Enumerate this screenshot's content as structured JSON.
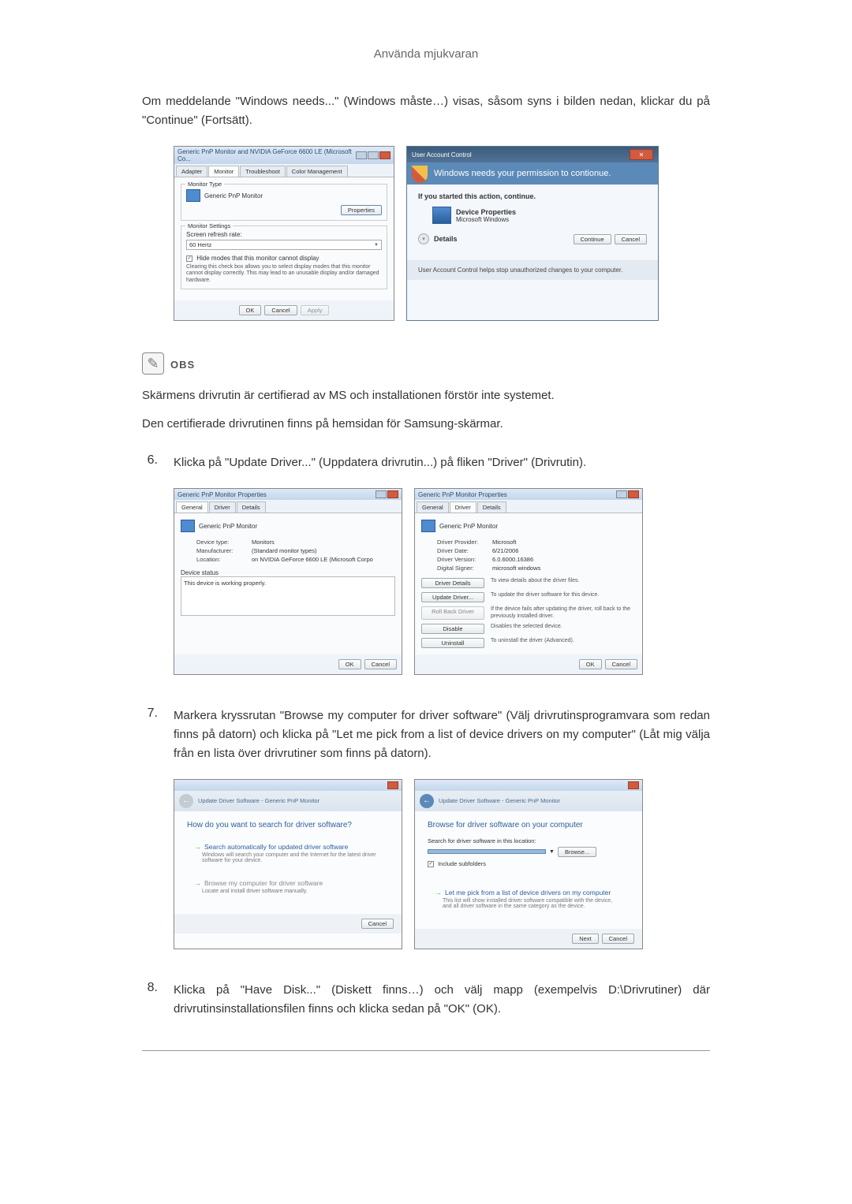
{
  "header": {
    "title": "Använda mjukvaran"
  },
  "intro_para": "Om meddelande \"Windows needs...\" (Windows måste…) visas, såsom syns i bilden nedan, klickar du på \"Continue\" (Fortsätt).",
  "fig1_left": {
    "title": "Generic PnP Monitor and NVIDIA GeForce 6600 LE (Microsoft Co...",
    "tabs": {
      "adapter": "Adapter",
      "monitor": "Monitor",
      "troubleshoot": "Troubleshoot",
      "color": "Color Management"
    },
    "group_monitor_type": "Monitor Type",
    "monitor_name": "Generic PnP Monitor",
    "btn_properties": "Properties",
    "group_monitor_settings": "Monitor Settings",
    "refresh_label": "Screen refresh rate:",
    "refresh_value": "60 Hertz",
    "hide_modes_check": "Hide modes that this monitor cannot display",
    "hide_modes_desc": "Clearing this check box allows you to select display modes that this monitor cannot display correctly. This may lead to an unusable display and/or damaged hardware.",
    "btn_ok": "OK",
    "btn_cancel": "Cancel",
    "btn_apply": "Apply"
  },
  "fig1_right": {
    "title": "User Account Control",
    "banner": "Windows needs your permission to contionue.",
    "sub": "If you started this action, continue.",
    "app_name": "Device Properties",
    "publisher": "Microsoft Windows",
    "details_label": "Details",
    "btn_continue": "Continue",
    "btn_cancel": "Cancel",
    "footer": "User Account Control helps stop unauthorized changes to your computer."
  },
  "note": {
    "label": "OBS",
    "line1": "Skärmens drivrutin är certifierad av MS och installationen förstör inte systemet.",
    "line2": "Den certifierade drivrutinen finns på hemsidan för Samsung-skärmar."
  },
  "step6": {
    "num": "6.",
    "text": "Klicka på \"Update Driver...\" (Uppdatera drivrutin...) på fliken \"Driver\" (Drivrutin)."
  },
  "fig2_left": {
    "title": "Generic PnP Monitor Properties",
    "tabs": {
      "general": "General",
      "driver": "Driver",
      "details": "Details"
    },
    "monitor_name": "Generic PnP Monitor",
    "fields": {
      "device_type_l": "Device type:",
      "device_type_v": "Monitors",
      "manufacturer_l": "Manufacturer:",
      "manufacturer_v": "(Standard monitor types)",
      "location_l": "Location:",
      "location_v": "on NVIDIA GeForce 6600 LE (Microsoft Corpo"
    },
    "status_label": "Device status",
    "status_text": "This device is working properly.",
    "btn_ok": "OK",
    "btn_cancel": "Cancel"
  },
  "fig2_right": {
    "title": "Generic PnP Monitor Properties",
    "tabs": {
      "general": "General",
      "driver": "Driver",
      "details": "Details"
    },
    "monitor_name": "Generic PnP Monitor",
    "fields": {
      "provider_l": "Driver Provider:",
      "provider_v": "Microsoft",
      "date_l": "Driver Date:",
      "date_v": "6/21/2006",
      "version_l": "Driver Version:",
      "version_v": "6.0.6000.16386",
      "signer_l": "Digital Signer:",
      "signer_v": "microsoft windows"
    },
    "btn_details": "Driver Details",
    "desc_details": "To view details about the driver files.",
    "btn_update": "Update Driver...",
    "desc_update": "To update the driver software for this device.",
    "btn_rollback": "Roll Back Driver",
    "desc_rollback": "If the device fails after updating the driver, roll back to the previously installed driver.",
    "btn_disable": "Disable",
    "desc_disable": "Disables the selected device.",
    "btn_uninstall": "Uninstall",
    "desc_uninstall": "To uninstall the driver (Advanced).",
    "btn_ok": "OK",
    "btn_cancel": "Cancel"
  },
  "step7": {
    "num": "7.",
    "text": "Markera kryssrutan \"Browse my computer for driver software\" (Välj drivrutinsprogramvara som redan finns på datorn) och klicka på \"Let me pick from a list of device drivers on my computer\" (Låt mig välja från en lista över drivrutiner som finns på datorn)."
  },
  "fig3_left": {
    "crumb": "Update Driver Software - Generic PnP Monitor",
    "heading": "How do you want to search for driver software?",
    "opt1_title": "Search automatically for updated driver software",
    "opt1_desc": "Windows will search your computer and the Internet for the latest driver software for your device.",
    "opt2_title": "Browse my computer for driver software",
    "opt2_desc": "Locate and install driver software manually.",
    "btn_cancel": "Cancel"
  },
  "fig3_right": {
    "crumb": "Update Driver Software - Generic PnP Monitor",
    "heading": "Browse for driver software on your computer",
    "search_label": "Search for driver software in this location:",
    "path_value": " ",
    "btn_browse": "Browse...",
    "include_sub": "Include subfolders",
    "opt_title": "Let me pick from a list of device drivers on my computer",
    "opt_desc": "This list will show installed driver software compatible with the device, and all driver software in the same category as the device.",
    "btn_next": "Next",
    "btn_cancel": "Cancel"
  },
  "step8": {
    "num": "8.",
    "text": "Klicka på \"Have Disk...\" (Diskett finns…) och välj mapp (exempelvis D:\\Drivrutiner) där drivrutinsinstallationsfilen finns och klicka sedan på \"OK\" (OK)."
  }
}
